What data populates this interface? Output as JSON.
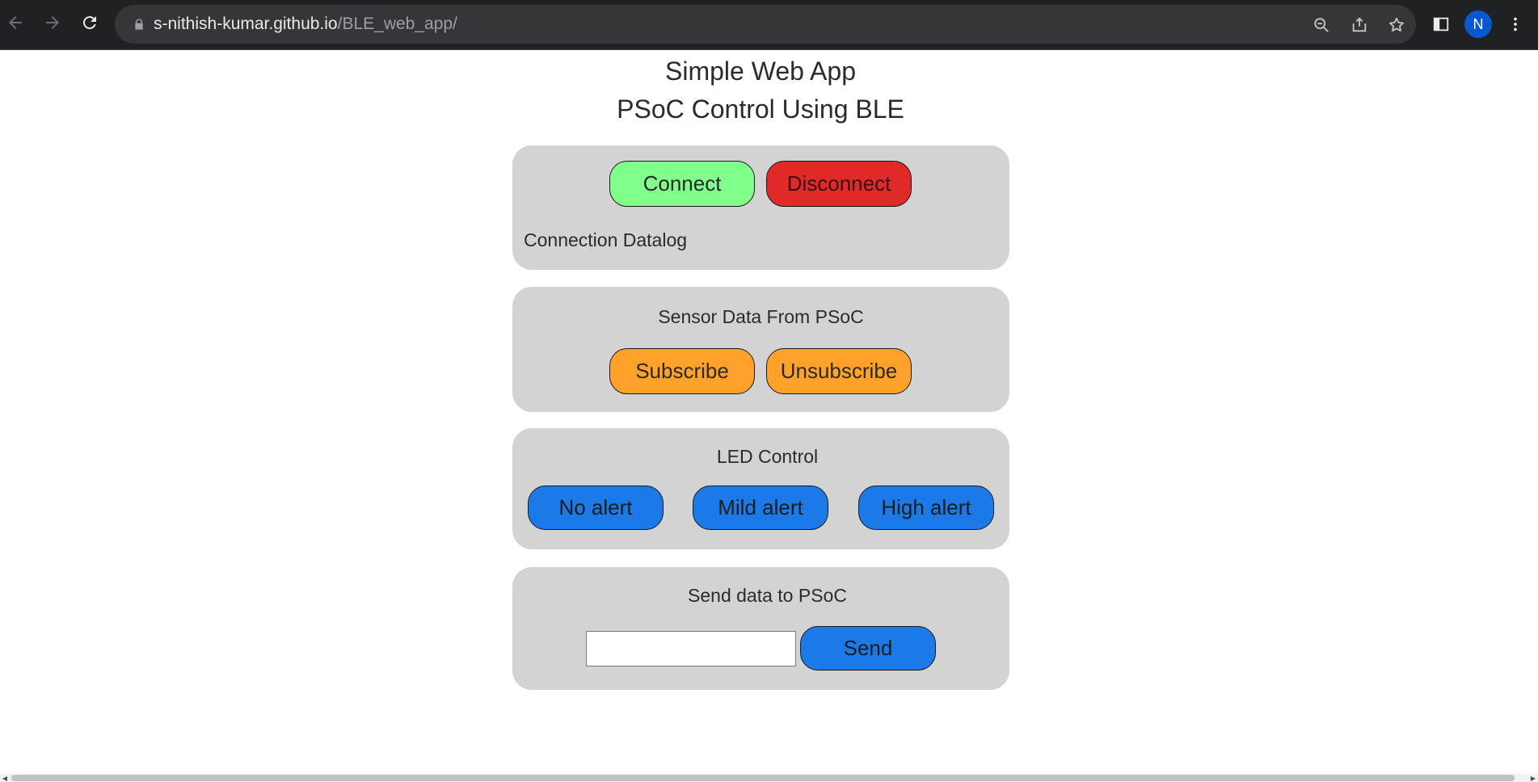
{
  "browser": {
    "url_host": "s-nithish-kumar.github.io",
    "url_path": "/BLE_web_app/",
    "profile_initial": "N",
    "icons": [
      "back-icon",
      "forward-icon",
      "reload-icon",
      "lock-icon",
      "zoom-out-icon",
      "share-icon",
      "bookmark-star-icon",
      "side-panel-icon",
      "more-menu-icon"
    ]
  },
  "page": {
    "title": "Simple Web App",
    "subtitle": "PSoC Control Using BLE"
  },
  "connection": {
    "connect_label": "Connect",
    "disconnect_label": "Disconnect",
    "datalog_label": "Connection Datalog"
  },
  "sensor": {
    "heading": "Sensor Data From PSoC",
    "subscribe_label": "Subscribe",
    "unsubscribe_label": "Unsubscribe"
  },
  "led": {
    "heading": "LED Control",
    "buttons": [
      {
        "label": "No alert"
      },
      {
        "label": "Mild alert"
      },
      {
        "label": "High alert"
      }
    ]
  },
  "send": {
    "heading": "Send data to PSoC",
    "input_value": "",
    "send_label": "Send"
  },
  "colors": {
    "connect": "#80ff8a",
    "disconnect": "#e02a2a",
    "subscribe": "#ffa12b",
    "led": "#1b7ae8",
    "card": "#d3d3d3"
  }
}
